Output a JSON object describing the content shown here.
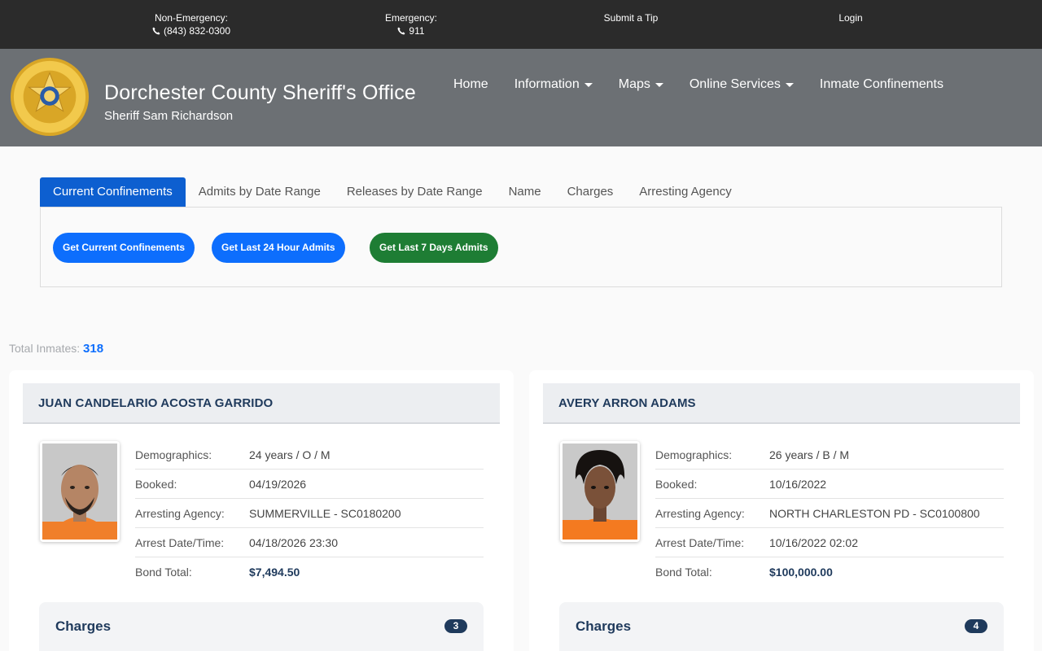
{
  "topbar": {
    "non_emergency_label": "Non-Emergency:",
    "non_emergency_phone": "(843) 832-0300",
    "emergency_label": "Emergency:",
    "emergency_phone": "911",
    "tip_label": "Submit a Tip",
    "login_label": "Login"
  },
  "header": {
    "title": "Dorchester County Sheriff's Office",
    "subtitle": "Sheriff Sam Richardson",
    "badge_text_top": "SHERIFF'S",
    "badge_text_mid": "OFFICE",
    "badge_text_bottom": "DORCHESTER COUNTY",
    "badge_state": "SOUTH CAROLINA",
    "nav": [
      {
        "label": "Home"
      },
      {
        "label": "Information"
      },
      {
        "label": "Maps"
      },
      {
        "label": "Online Services"
      },
      {
        "label": "Inmate Confinements"
      }
    ]
  },
  "tabs": [
    {
      "label": "Current Confinements",
      "active": true
    },
    {
      "label": "Admits by Date Range"
    },
    {
      "label": "Releases by Date Range"
    },
    {
      "label": "Name"
    },
    {
      "label": "Charges"
    },
    {
      "label": "Arresting Agency"
    }
  ],
  "actions": {
    "current": "Get Current Confinements",
    "last24": "Get Last 24 Hour Admits",
    "last7": "Get Last 7 Days Admits"
  },
  "total": {
    "label": "Total Inmates:",
    "value": "318"
  },
  "labels": {
    "demographics": "Demographics:",
    "booked": "Booked:",
    "agency": "Arresting Agency:",
    "arrest": "Arrest Date/Time:",
    "bond": "Bond Total:",
    "charges": "Charges"
  },
  "inmates": [
    {
      "name": "JUAN CANDELARIO ACOSTA GARRIDO",
      "demographics": "24 years / O / M",
      "booked": "04/19/2026",
      "agency": "SUMMERVILLE - SC0180200",
      "arrest": "04/18/2026 23:30",
      "bond": "$7,494.50",
      "charge_count": "3"
    },
    {
      "name": "AVERY ARRON ADAMS",
      "demographics": "26 years / B / M",
      "booked": "10/16/2022",
      "agency": "NORTH CHARLESTON PD - SC0100800",
      "arrest": "10/16/2022 02:02",
      "bond": "$100,000.00",
      "charge_count": "4"
    }
  ],
  "colors": {
    "topbar": "#2b2b2b",
    "header": "#6c7074",
    "primary": "#0d6efd",
    "success": "#1e7d34",
    "navy": "#1f3a5c"
  }
}
